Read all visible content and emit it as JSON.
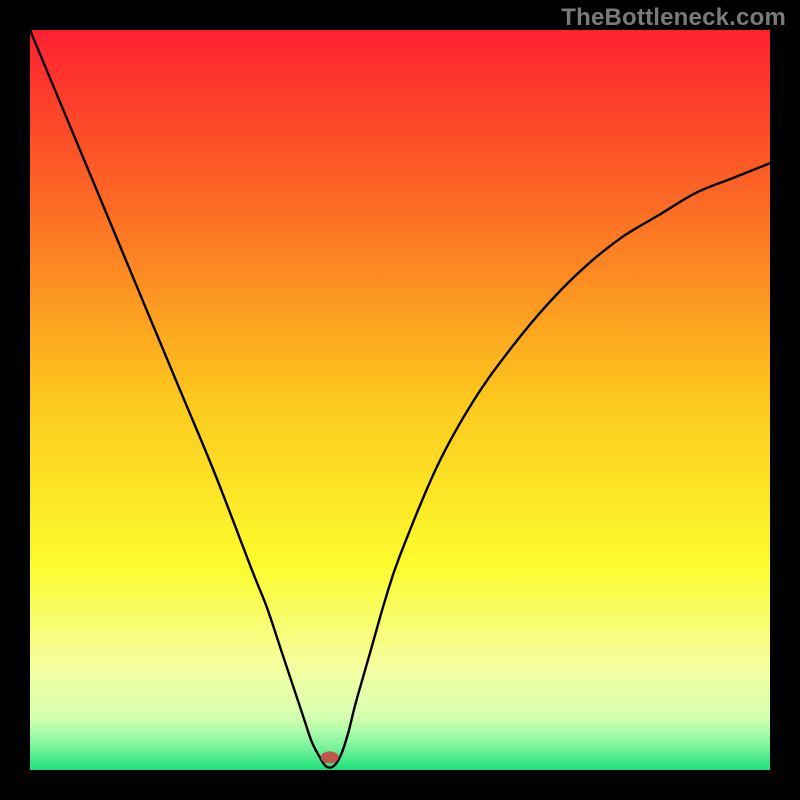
{
  "watermark": {
    "text": "TheBottleneck.com"
  },
  "chart_data": {
    "type": "line",
    "title": "",
    "xlabel": "",
    "ylabel": "",
    "xlim": [
      0,
      100
    ],
    "ylim": [
      0,
      100
    ],
    "series": [
      {
        "name": "bottleneck-curve",
        "x": [
          0,
          5,
          10,
          15,
          20,
          25,
          30,
          32,
          34,
          36,
          37,
          38,
          39,
          40,
          41,
          42,
          43,
          44,
          46,
          48,
          50,
          55,
          60,
          65,
          70,
          75,
          80,
          85,
          90,
          95,
          100
        ],
        "values": [
          100,
          88,
          76,
          64,
          52,
          40,
          27,
          22,
          16,
          10,
          7,
          4,
          2,
          0.5,
          0.5,
          2,
          5,
          9,
          16,
          23,
          29,
          41,
          50,
          57,
          63,
          68,
          72,
          75,
          78,
          80,
          82
        ]
      }
    ],
    "gradient_stops": [
      {
        "offset": 0.0,
        "color": "#fe2030"
      },
      {
        "offset": 0.25,
        "color": "#fc6f24"
      },
      {
        "offset": 0.5,
        "color": "#fcc81e"
      },
      {
        "offset": 0.72,
        "color": "#fcfb2c"
      },
      {
        "offset": 0.86,
        "color": "#f6ffa0"
      },
      {
        "offset": 0.93,
        "color": "#d4ffb0"
      },
      {
        "offset": 0.965,
        "color": "#84f5a0"
      },
      {
        "offset": 1.0,
        "color": "#1ee07a"
      }
    ],
    "marker": {
      "x": 40.5,
      "y": 1.7,
      "color": "#c0564d",
      "rx": 9,
      "ry": 6
    }
  }
}
